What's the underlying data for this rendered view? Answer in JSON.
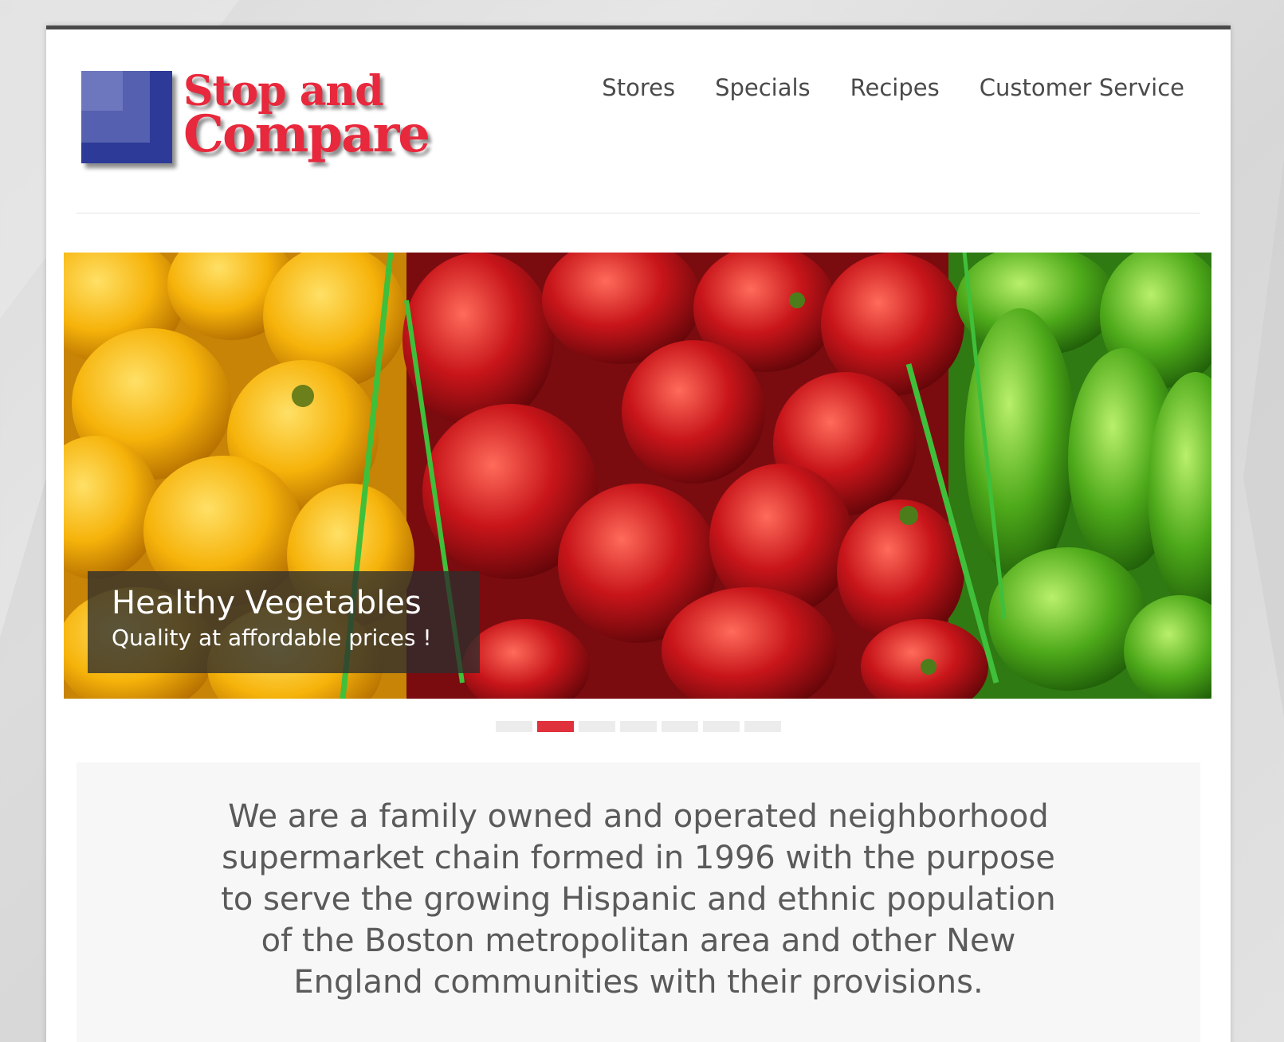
{
  "logo": {
    "line1": "Stop and",
    "line2": "Compare",
    "brand_color": "#e8283c",
    "square_color": "#2d3a97"
  },
  "nav": {
    "items": [
      {
        "label": "Stores"
      },
      {
        "label": "Specials"
      },
      {
        "label": "Recipes"
      },
      {
        "label": "Customer Service"
      }
    ]
  },
  "hero": {
    "caption_title": "Healthy Vegetables",
    "caption_subtitle": "Quality at affordable prices !",
    "slide_count": 7,
    "active_slide": 2,
    "active_dot_color": "#e0323c"
  },
  "about": {
    "text": "We are a family owned and operated neighborhood supermarket chain formed in 1996 with the purpose to serve the growing Hispanic and ethnic population of the Boston metropolitan area and other New England communities with their provisions."
  }
}
